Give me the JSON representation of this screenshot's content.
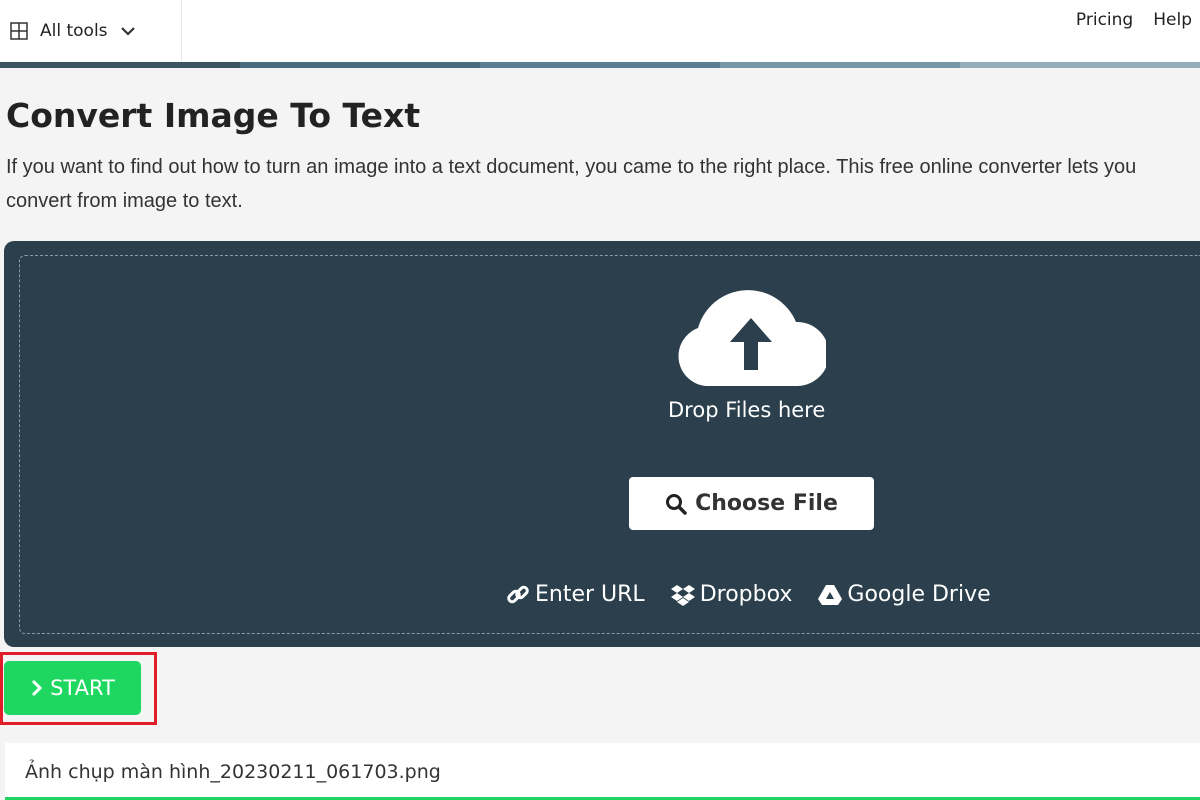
{
  "header": {
    "all_tools": "All tools",
    "nav": [
      "Pricing",
      "Help"
    ]
  },
  "page": {
    "title": "Convert Image To Text",
    "description": "If you want to find out how to turn an image into a text document, you came to the right place. This free online converter lets you convert from image to text."
  },
  "upload": {
    "drop_text": "Drop Files here",
    "choose_file": "Choose File",
    "links": [
      "Enter URL",
      "Dropbox",
      "Google Drive"
    ]
  },
  "start_label": "START",
  "file": {
    "name": "Ảnh chụp màn hình_20230211_061703.png"
  },
  "colors": {
    "accent_green": "#1ed760",
    "dropzone_bg": "#2b3f4c",
    "highlight": "#e01e2b",
    "stripe": [
      "#3b5564",
      "#4b6c80",
      "#5d7d91",
      "#7796a8",
      "#95adbb"
    ]
  }
}
